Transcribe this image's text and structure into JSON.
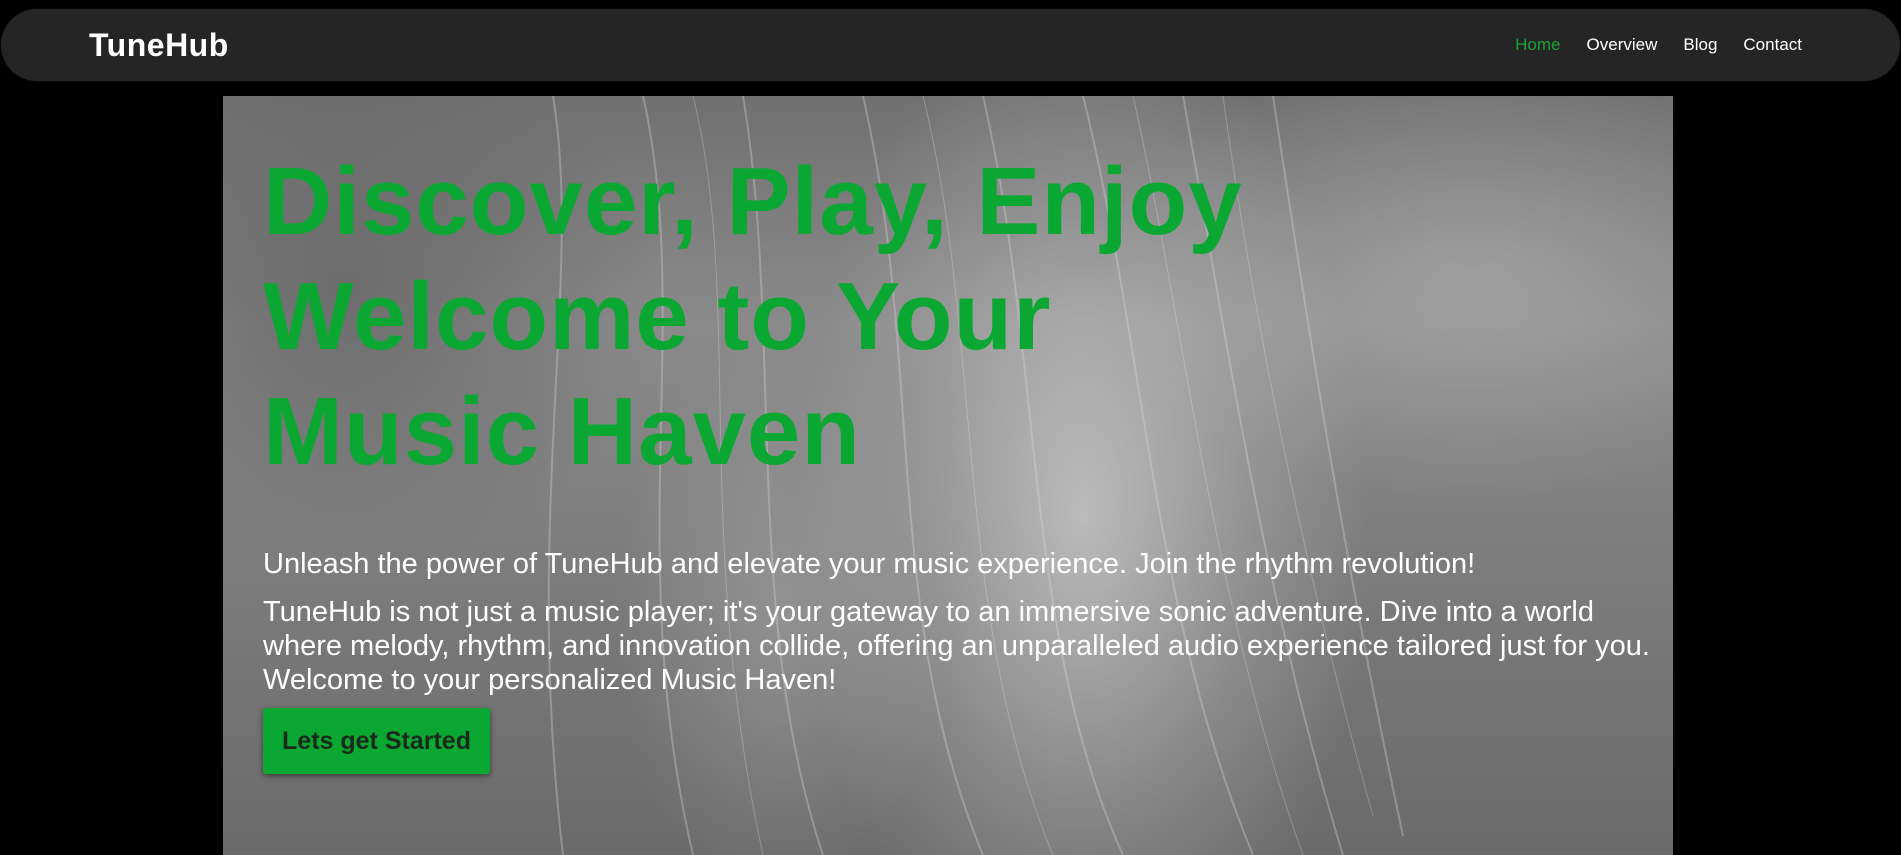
{
  "brand": "TuneHub",
  "nav": {
    "items": [
      {
        "label": "Home",
        "active": true
      },
      {
        "label": "Overview",
        "active": false
      },
      {
        "label": "Blog",
        "active": false
      },
      {
        "label": "Contact",
        "active": false
      }
    ]
  },
  "hero": {
    "headline_lines": [
      "Discover, Play, Enjoy",
      "Welcome to Your",
      "Music Haven"
    ],
    "tagline": "Unleash the power of TuneHub and elevate your music experience. Join the rhythm revolution!",
    "description": "TuneHub is not just a music player; it's your gateway to an immersive sonic adventure. Dive into a world where melody, rhythm, and innovation collide, offering an unparalleled audio experience tailored just for you. Welcome to your personalized Music Haven!",
    "cta_label": "Lets get Started",
    "background_image": "grayscale photo of a person with long hair"
  },
  "colors": {
    "accent": "#0aa832",
    "nav_active": "#17a135",
    "navbar_bg": "#252525",
    "page_bg": "#000000"
  }
}
